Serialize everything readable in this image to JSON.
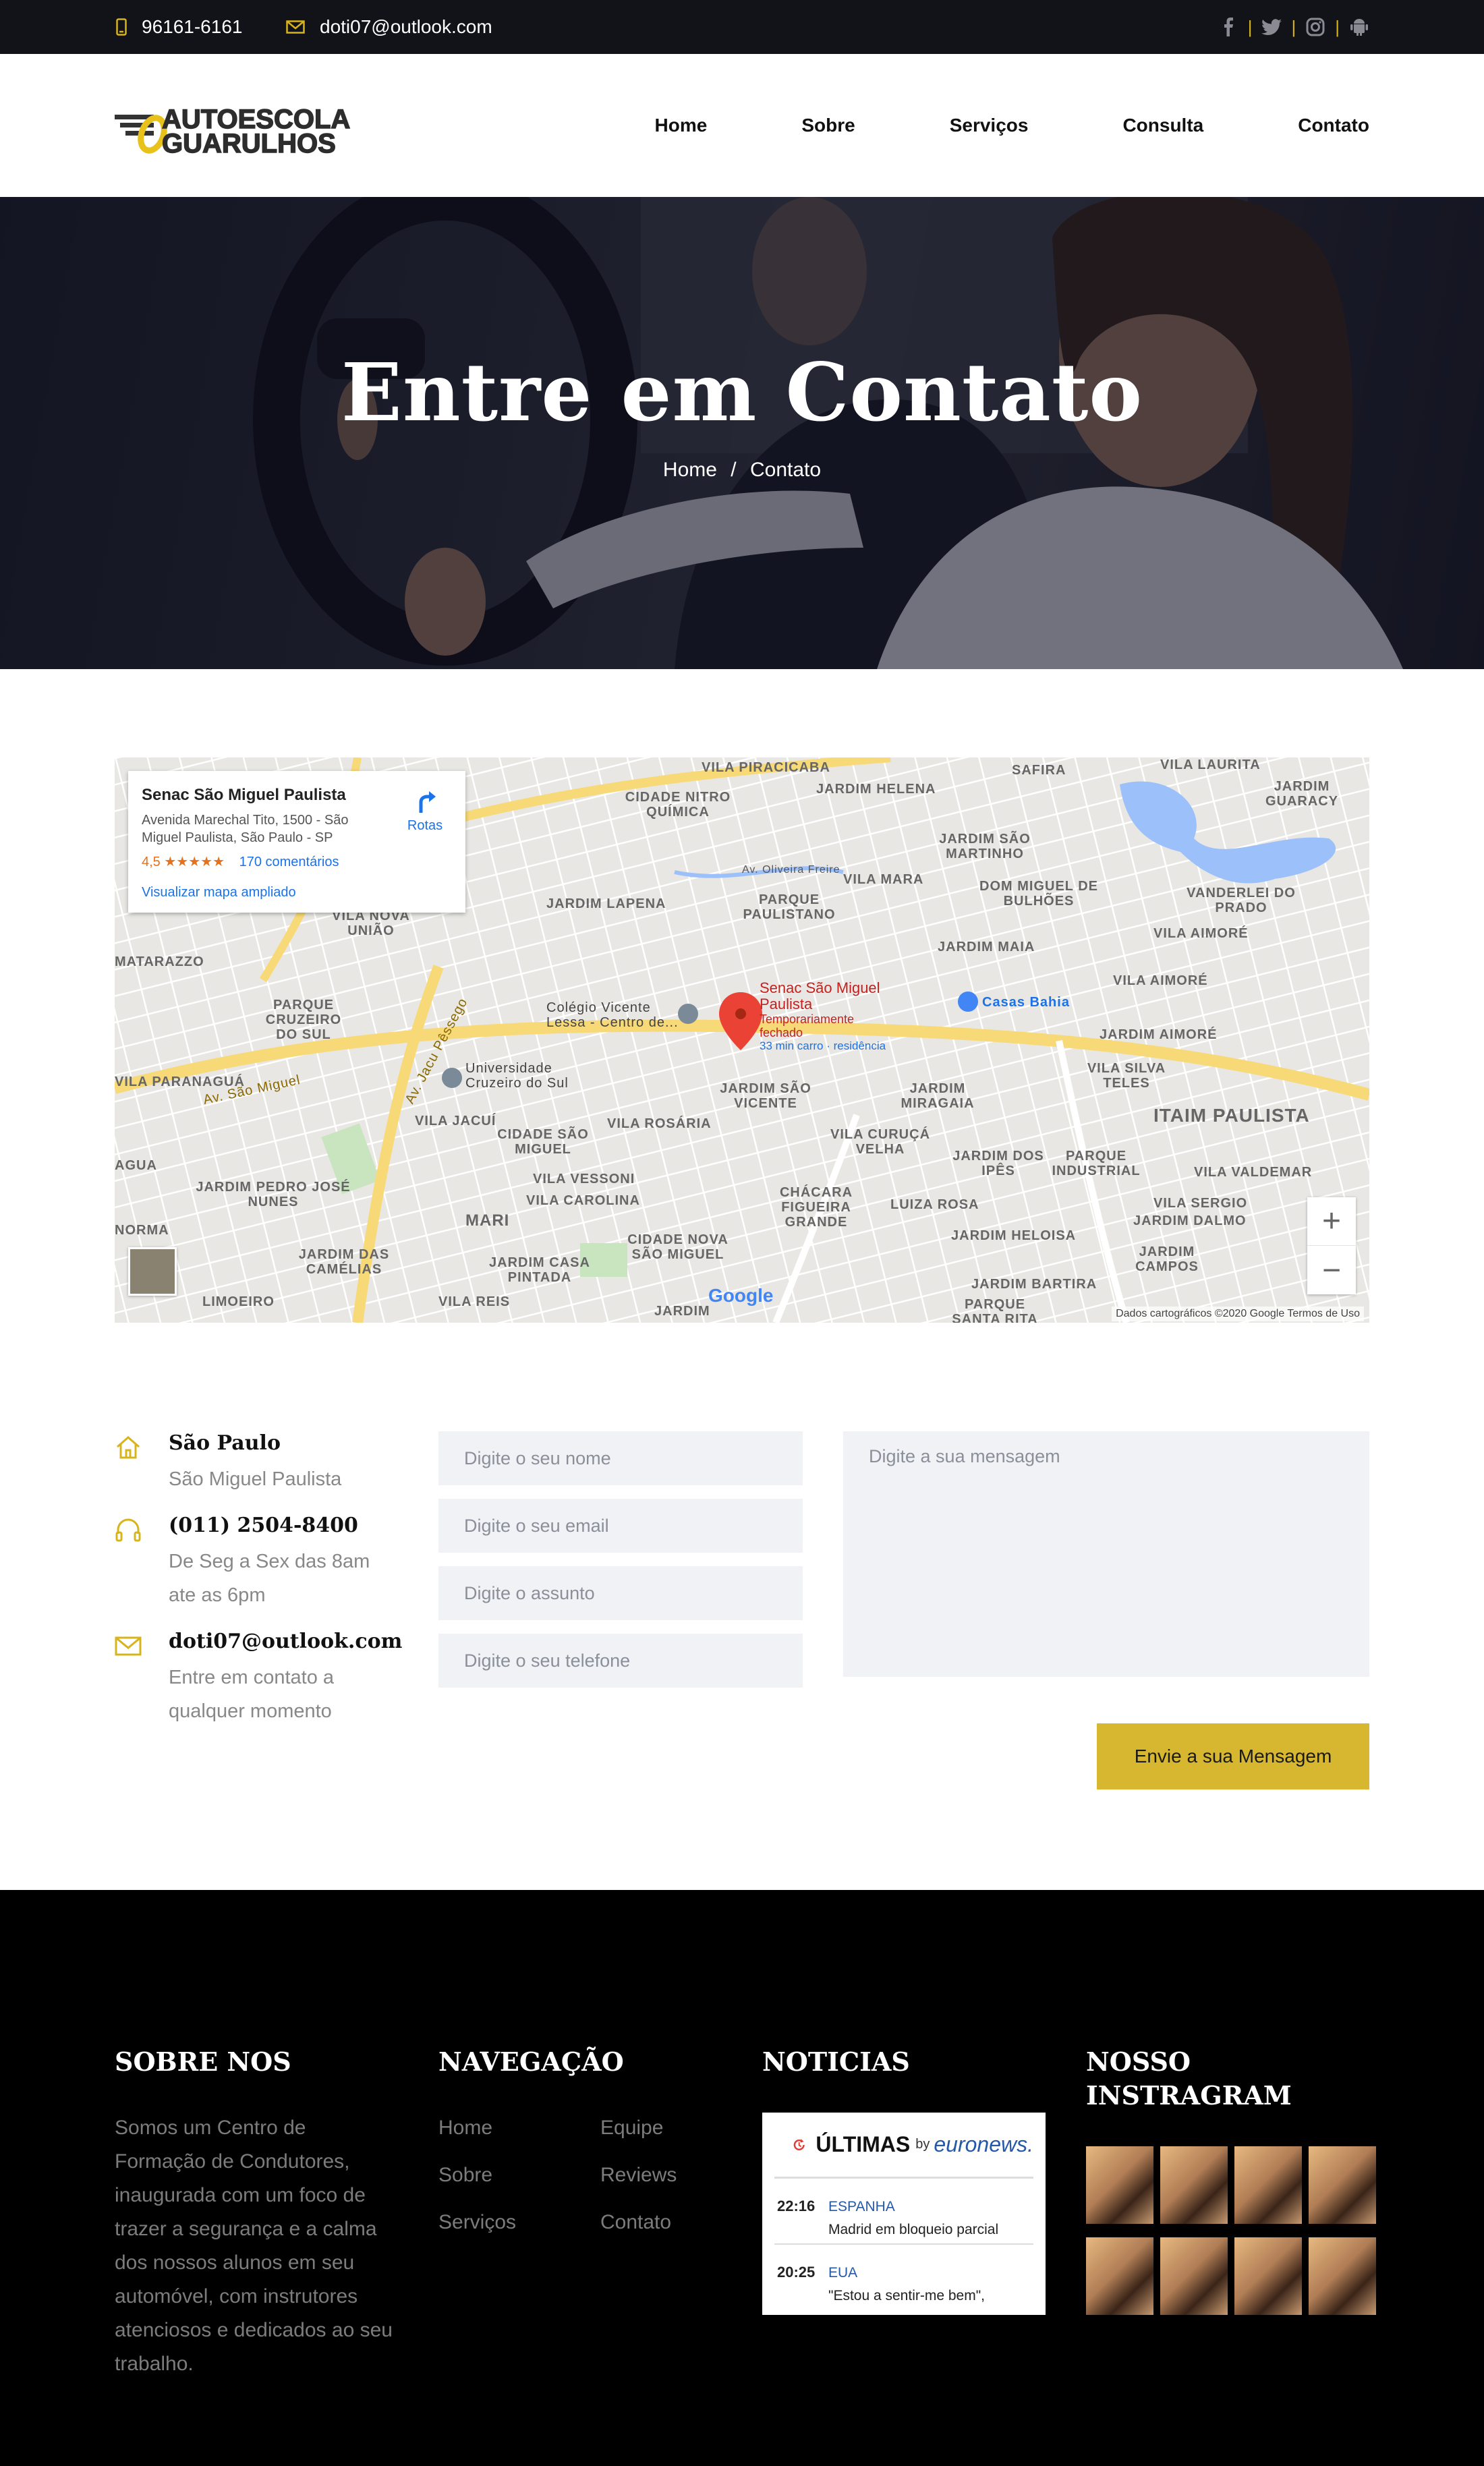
{
  "topbar": {
    "phone": "96161-6161",
    "email": "doti07@outlook.com",
    "social_icons": [
      "facebook-icon",
      "twitter-icon",
      "instagram-icon",
      "android-icon"
    ],
    "separator": "|"
  },
  "header": {
    "logo_line1": "AUTOESCOLA",
    "logo_line2": "GUARULHOS",
    "nav": [
      "Home",
      "Sobre",
      "Serviços",
      "Consulta",
      "Contato"
    ]
  },
  "hero": {
    "title": "Entre em Contato",
    "breadcrumb_home": "Home",
    "breadcrumb_sep": "/",
    "breadcrumb_current": "Contato"
  },
  "map": {
    "place_name": "Senac São Miguel Paulista",
    "address": "Avenida Marechal Tito, 1500 - São Miguel Paulista, São Paulo - SP",
    "rating": "4,5 ★★★★★",
    "reviews": "170 comentários",
    "view_larger": "Visualizar mapa ampliado",
    "directions": "Rotas",
    "zoom_in": "+",
    "zoom_out": "−",
    "attribution": "Dados cartográficos ©2020 Google    Termos de Uso",
    "google_logo": "Google",
    "marker_label": "Senac São Miguel Paulista",
    "marker_status": "Temporariamente fechado",
    "marker_time": "33 min carro · residência",
    "labels": [
      "VILA PIRACICABA",
      "SAFIRA",
      "VILA LAURITA",
      "JARDIM GUARACY",
      "CIDADE NITRO QUÍMICA",
      "JARDIM HELENA",
      "JARDIM SÃO MARTINHO",
      "JARDIM LAPENA",
      "PARQUE PAULISTANO",
      "VILA MARA",
      "DOM MIGUEL DE BULHÕES",
      "VANDERLEI DO PRADO",
      "VILA NOVA UNIÃO",
      "JARDIM MAIA",
      "VILA AIMORÉ",
      "PARQUE CRUZEIRO DO SUL",
      "Colégio Vicente Lessa - Centro de...",
      "Casas Bahia",
      "JARDIM AIMORÉ",
      "Universidade Cruzeiro do Sul",
      "VILA PARANAGUÁ",
      "JARDIM SÃO VICENTE",
      "JARDIM MIRAGAIA",
      "VILA SILVA TELES",
      "ITAIM PAULISTA",
      "VILA JACUÍ",
      "CIDADE SÃO MIGUEL",
      "VILA ROSÁRIA",
      "VILA CURUÇÁ VELHA",
      "JARDIM DOS IPÊS",
      "PARQUE INDUSTRIAL",
      "VILA VALDEMAR",
      "JARDIM PEDRO JOSÉ NUNES",
      "VILA VESSONI",
      "VILA CAROLINA",
      "CHÁCARA FIGUEIRA GRANDE",
      "LUIZA ROSA",
      "VILA SERGIO",
      "JARDIM DALMO",
      "MARI",
      "CIDADE NOVA SÃO MIGUEL",
      "JARDIM HELOISA",
      "JARDIM CAMPOS",
      "JARDIM DAS CAMÉLIAS",
      "JARDIM CASA PINTADA",
      "JARDIM BARTIRA",
      "LIMOEIRO",
      "VILA REIS",
      "PARQUE SANTA RITA",
      "JARDIM",
      "Av. São Miguel",
      "Av. Jacu Pêssego",
      "Av. Oliveira Freire",
      "MATARAZZO",
      "NORMA",
      "AGUA"
    ]
  },
  "contact": {
    "city_title": "São Paulo",
    "city_sub": "São Miguel Paulista",
    "phone_title": "(011) 2504-8400",
    "phone_sub": "De Seg a Sex das 8am ate as 6pm",
    "email_title": "doti07@outlook.com",
    "email_sub": "Entre em contato a qualquer momento",
    "name_placeholder": "Digite o seu nome",
    "email_placeholder": "Digite o seu email",
    "subject_placeholder": "Digite o assunto",
    "phone_placeholder": "Digite o seu telefone",
    "message_placeholder": "Digite a sua mensagem",
    "submit_label": "Envie a sua Mensagem"
  },
  "footer": {
    "about_title": "SOBRE NOS",
    "about_text": "Somos um Centro de Formação de Condutores, inaugurada com um foco de trazer a segurança e a calma dos nossos alunos em seu automóvel, com instrutores atenciosos e dedicados ao seu trabalho.",
    "nav_title": "NAVEGAÇÃO",
    "nav_links_col1": [
      "Home",
      "Sobre",
      "Serviços"
    ],
    "nav_links_col2": [
      "Equipe",
      "Reviews",
      "Contato"
    ],
    "news_title": "NOTICIAS",
    "news_widget": {
      "heading": "ÚLTIMAS",
      "by": "by",
      "brand": "euronews.",
      "items": [
        {
          "time": "22:16",
          "category": "ESPANHA",
          "text": "Madrid em bloqueio parcial"
        },
        {
          "time": "20:25",
          "category": "EUA",
          "text": "\"Estou a sentir-me bem\","
        }
      ]
    },
    "insta_title": "NOSSO INSTRAGRAM"
  },
  "colors": {
    "accent": "#d8b730",
    "topbar_bg": "#121219",
    "footer_bg": "#000000",
    "field_bg": "#f1f2f6"
  }
}
